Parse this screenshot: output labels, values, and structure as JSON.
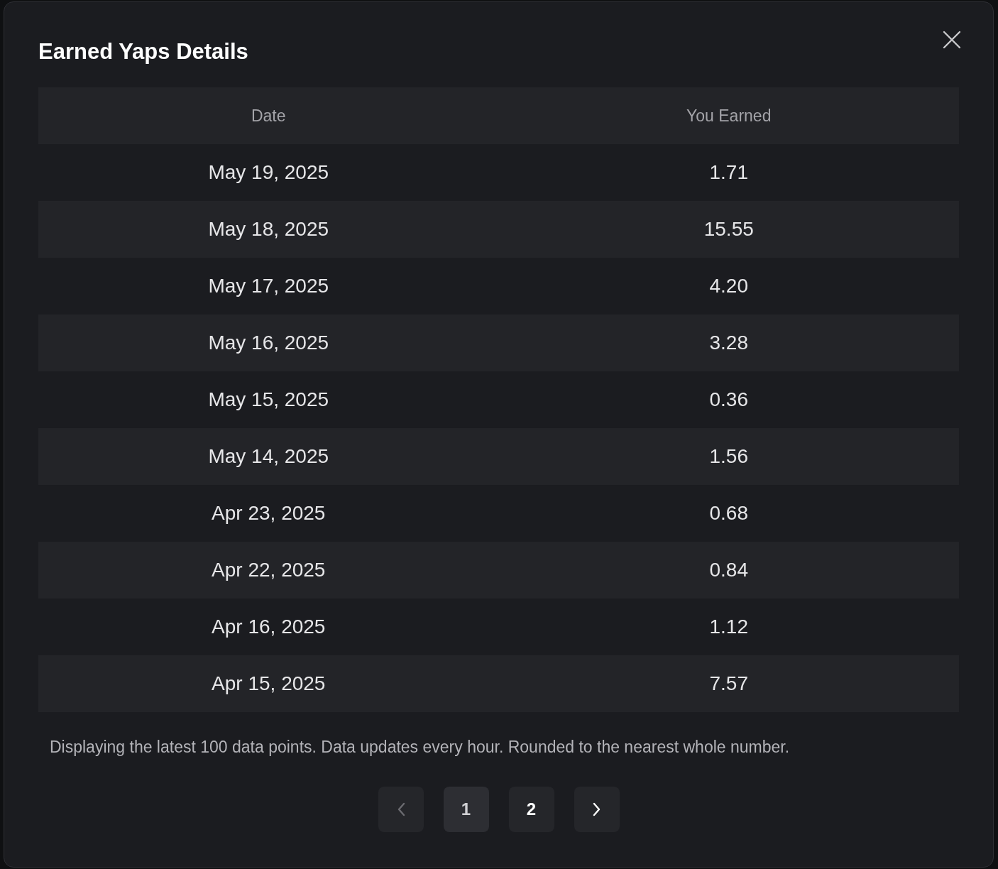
{
  "dialog": {
    "title": "Earned Yaps Details"
  },
  "table": {
    "columns": [
      "Date",
      "You Earned"
    ],
    "rows": [
      {
        "date": "May 19, 2025",
        "earned": "1.71"
      },
      {
        "date": "May 18, 2025",
        "earned": "15.55"
      },
      {
        "date": "May 17, 2025",
        "earned": "4.20"
      },
      {
        "date": "May 16, 2025",
        "earned": "3.28"
      },
      {
        "date": "May 15, 2025",
        "earned": "0.36"
      },
      {
        "date": "May 14, 2025",
        "earned": "1.56"
      },
      {
        "date": "Apr 23, 2025",
        "earned": "0.68"
      },
      {
        "date": "Apr 22, 2025",
        "earned": "0.84"
      },
      {
        "date": "Apr 16, 2025",
        "earned": "1.12"
      },
      {
        "date": "Apr 15, 2025",
        "earned": "7.57"
      }
    ]
  },
  "note": "Displaying the latest 100 data points. Data updates every hour. Rounded to the nearest whole number.",
  "pagination": {
    "previous": {
      "disabled": true
    },
    "pages": [
      {
        "label": "1",
        "selected": true
      },
      {
        "label": "2",
        "selected": false
      }
    ],
    "next": {
      "disabled": false
    }
  }
}
